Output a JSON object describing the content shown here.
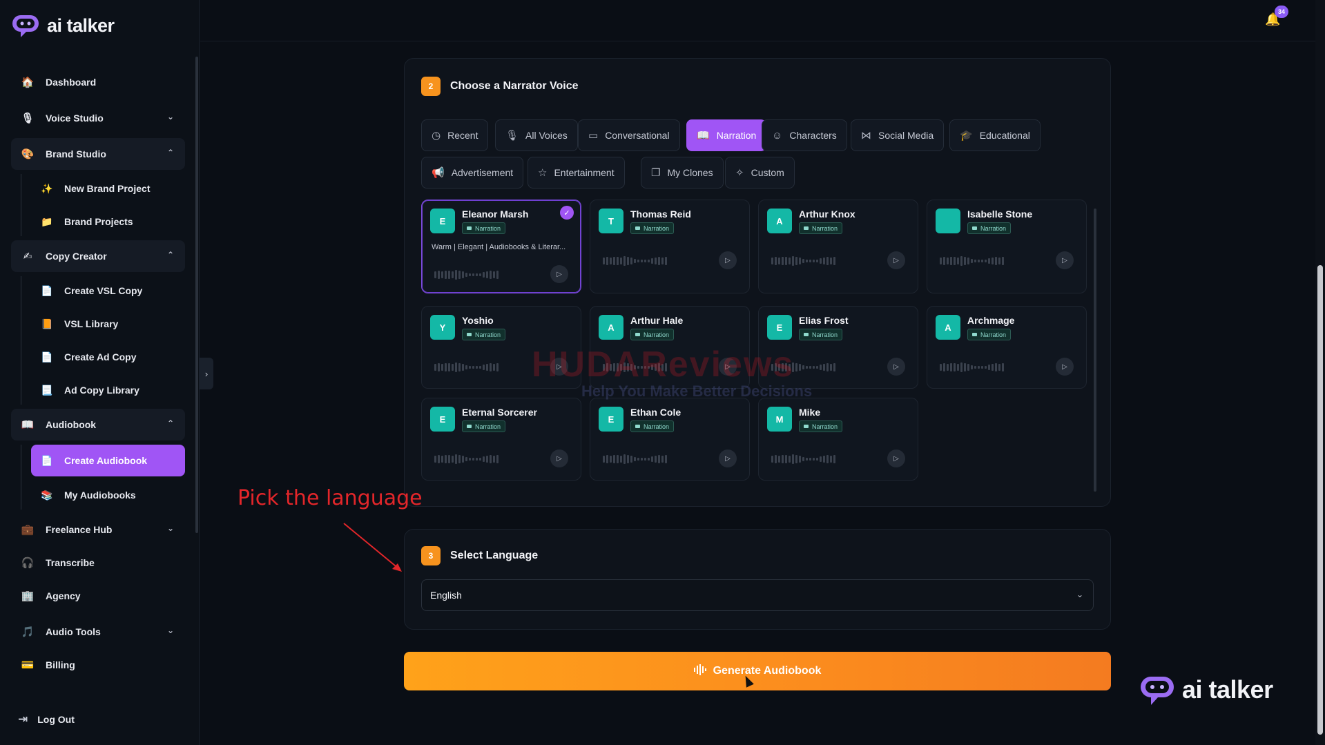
{
  "app": {
    "logo_text": "ai talker",
    "notifications": "34"
  },
  "sidebar": {
    "items": [
      {
        "label": "Dashboard",
        "icon": "home-icon"
      },
      {
        "label": "Voice Studio",
        "icon": "microphone-icon"
      },
      {
        "label": "Brand Studio",
        "icon": "palette-icon"
      },
      {
        "label": "New Brand Project",
        "icon": "sparkle-icon"
      },
      {
        "label": "Brand Projects",
        "icon": "folder-icon"
      },
      {
        "label": "Copy Creator",
        "icon": "pen-icon"
      },
      {
        "label": "Create VSL Copy",
        "icon": "doc-icon"
      },
      {
        "label": "VSL Library",
        "icon": "library-icon"
      },
      {
        "label": "Create Ad Copy",
        "icon": "doc-icon"
      },
      {
        "label": "Ad Copy Library",
        "icon": "doc-icon"
      },
      {
        "label": "Audiobook",
        "icon": "book-icon"
      },
      {
        "label": "Create Audiobook",
        "icon": "doc-icon"
      },
      {
        "label": "My Audiobooks",
        "icon": "books-icon"
      },
      {
        "label": "Freelance Hub",
        "icon": "briefcase-icon"
      },
      {
        "label": "Transcribe",
        "icon": "transcribe-icon"
      },
      {
        "label": "Agency",
        "icon": "building-icon"
      },
      {
        "label": "Audio Tools",
        "icon": "music-icon"
      },
      {
        "label": "Billing",
        "icon": "card-icon"
      }
    ],
    "logout": "Log Out"
  },
  "step2": {
    "num": "2",
    "title": "Choose a Narrator Voice",
    "tabs": [
      "Recent",
      "All Voices",
      "Conversational",
      "Narration",
      "Characters",
      "Social Media",
      "Educational",
      "Advertisement",
      "Entertainment",
      "My Clones",
      "Custom"
    ],
    "active_tab": "Narration"
  },
  "voices": [
    {
      "name": "Eleanor Marsh",
      "initial": "E",
      "tag": "Narration",
      "desc": "Warm | Elegant | Audiobooks & Literar...",
      "selected": true
    },
    {
      "name": "Thomas Reid",
      "initial": "T",
      "tag": "Narration"
    },
    {
      "name": "Arthur Knox",
      "initial": "A",
      "tag": "Narration"
    },
    {
      "name": "Isabelle Stone",
      "initial": "",
      "tag": "Narration"
    },
    {
      "name": "Yoshio",
      "initial": "Y",
      "tag": "Narration"
    },
    {
      "name": "Arthur Hale",
      "initial": "A",
      "tag": "Narration"
    },
    {
      "name": "Elias Frost",
      "initial": "E",
      "tag": "Narration"
    },
    {
      "name": "Archmage",
      "initial": "A",
      "tag": "Narration"
    },
    {
      "name": "Eternal Sorcerer",
      "initial": "E",
      "tag": "Narration"
    },
    {
      "name": "Ethan Cole",
      "initial": "E",
      "tag": "Narration"
    },
    {
      "name": "Mike",
      "initial": "M",
      "tag": "Narration"
    }
  ],
  "step3": {
    "num": "3",
    "title": "Select Language",
    "language": "English"
  },
  "generate_label": "Generate Audiobook",
  "annotation": "Pick the language",
  "watermark": {
    "line1": "HUDAReviews",
    "line2": "Help You Make Better Decisions"
  },
  "colors": {
    "accent": "#a055f5",
    "orange": "#f7931e",
    "teal": "#14b8a6"
  }
}
